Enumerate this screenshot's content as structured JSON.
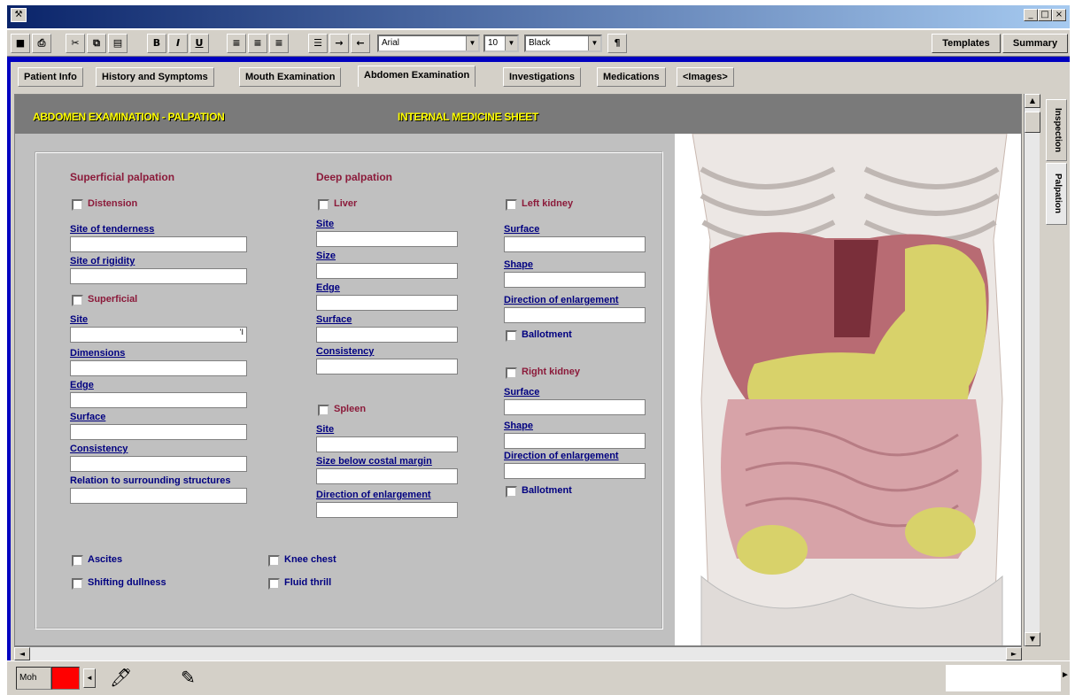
{
  "window": {
    "min": "_",
    "max": "□",
    "close": "×"
  },
  "toolbar": {
    "save": "■",
    "print": "⎙",
    "cut": "✂",
    "copy": "⧉",
    "paste": "▤",
    "bold": "B",
    "italic": "I",
    "underline": "U",
    "align_left": "≡",
    "align_center": "≡",
    "align_right": "≡",
    "list": "☰",
    "indent": "→",
    "outdent": "←",
    "font": "Arial",
    "size": "10",
    "color": "Black",
    "format": "¶",
    "templates": "Templates",
    "summary": "Summary"
  },
  "tabs": [
    "Patient Info",
    "History and Symptoms",
    "Mouth Examination",
    "Abdomen Examination",
    "Investigations",
    "Medications",
    "<Images>"
  ],
  "banner": {
    "left": "ABDOMEN EXAMINATION - PALPATION",
    "center": "INTERNAL MEDICINE SHEET"
  },
  "superficial": {
    "title": "Superficial palpation",
    "distension": "Distension",
    "site_tenderness": "Site of tenderness",
    "site_rigidity": "Site of rigidity",
    "superficial": "Superficial",
    "site": "Site",
    "site_value": "'I",
    "dimensions": "Dimensions",
    "edge": "Edge",
    "surface": "Surface",
    "consistency": "Consistency",
    "relation": "Relation to surrounding structures"
  },
  "deep": {
    "title": "Deep palpation",
    "liver": "Liver",
    "site": "Site",
    "size": "Size",
    "edge": "Edge",
    "surface": "Surface",
    "consistency": "Consistency",
    "spleen": "Spleen",
    "spleen_site": "Site",
    "size_below": "Size below costal margin",
    "direction": "Direction of enlargement"
  },
  "left_kidney": {
    "title": "Left kidney",
    "surface": "Surface",
    "shape": "Shape",
    "direction": "Direction of enlargement",
    "ballotment": "Ballotment"
  },
  "right_kidney": {
    "title": "Right kidney",
    "surface": "Surface",
    "shape": "Shape",
    "direction": "Direction of enlargement",
    "ballotment": "Ballotment"
  },
  "bottom": {
    "ascites": "Ascites",
    "shifting": "Shifting dullness",
    "knee": "Knee chest",
    "fluid": "Fluid thrill"
  },
  "side_tabs": [
    "Inspection",
    "Palpation"
  ],
  "status": {
    "user": "Moh"
  },
  "colors": {
    "accent": "#0000c0",
    "banner_text": "#ffff00",
    "section": "#8b1a3a",
    "label": "#000080",
    "status_swatch": "#ff0000"
  }
}
